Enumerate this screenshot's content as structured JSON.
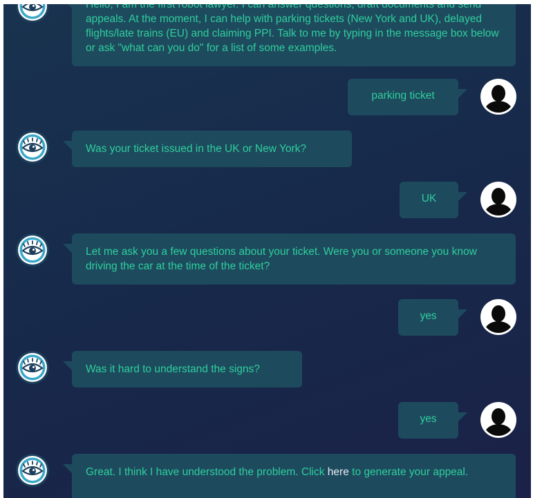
{
  "messages": [
    {
      "from": "bot",
      "text": "Hello, I am the first robot lawyer. I can answer questions, draft documents and send appeals. At the moment, I can help with parking tickets (New York and UK), delayed flights/late trains (EU) and claiming PPI. Talk to me by typing in the message box below or ask \"what can you do\" for a list of some examples."
    },
    {
      "from": "user",
      "text": "parking ticket"
    },
    {
      "from": "bot",
      "text": "Was your ticket issued in the UK or New York?"
    },
    {
      "from": "user",
      "text": "UK"
    },
    {
      "from": "bot",
      "text": "Let me ask you a few questions about your ticket. Were you or someone you know driving the car at the time of the ticket?"
    },
    {
      "from": "user",
      "text": "yes"
    },
    {
      "from": "bot",
      "text": "Was it hard to understand the signs?"
    },
    {
      "from": "user",
      "text": "yes"
    },
    {
      "from": "bot",
      "text_before": "Great. I think I have understood the problem. Click ",
      "link_text": "here",
      "text_after": " to generate your appeal."
    }
  ],
  "icons": {
    "bot_avatar": "eye-icon",
    "user_avatar": "user-silhouette-icon"
  },
  "colors": {
    "background": "#17284a",
    "bubble": "#1e4a5e",
    "text": "#2ecf9c",
    "link": "#e6eef2",
    "bot_avatar_ring": "#3aa8c8"
  }
}
